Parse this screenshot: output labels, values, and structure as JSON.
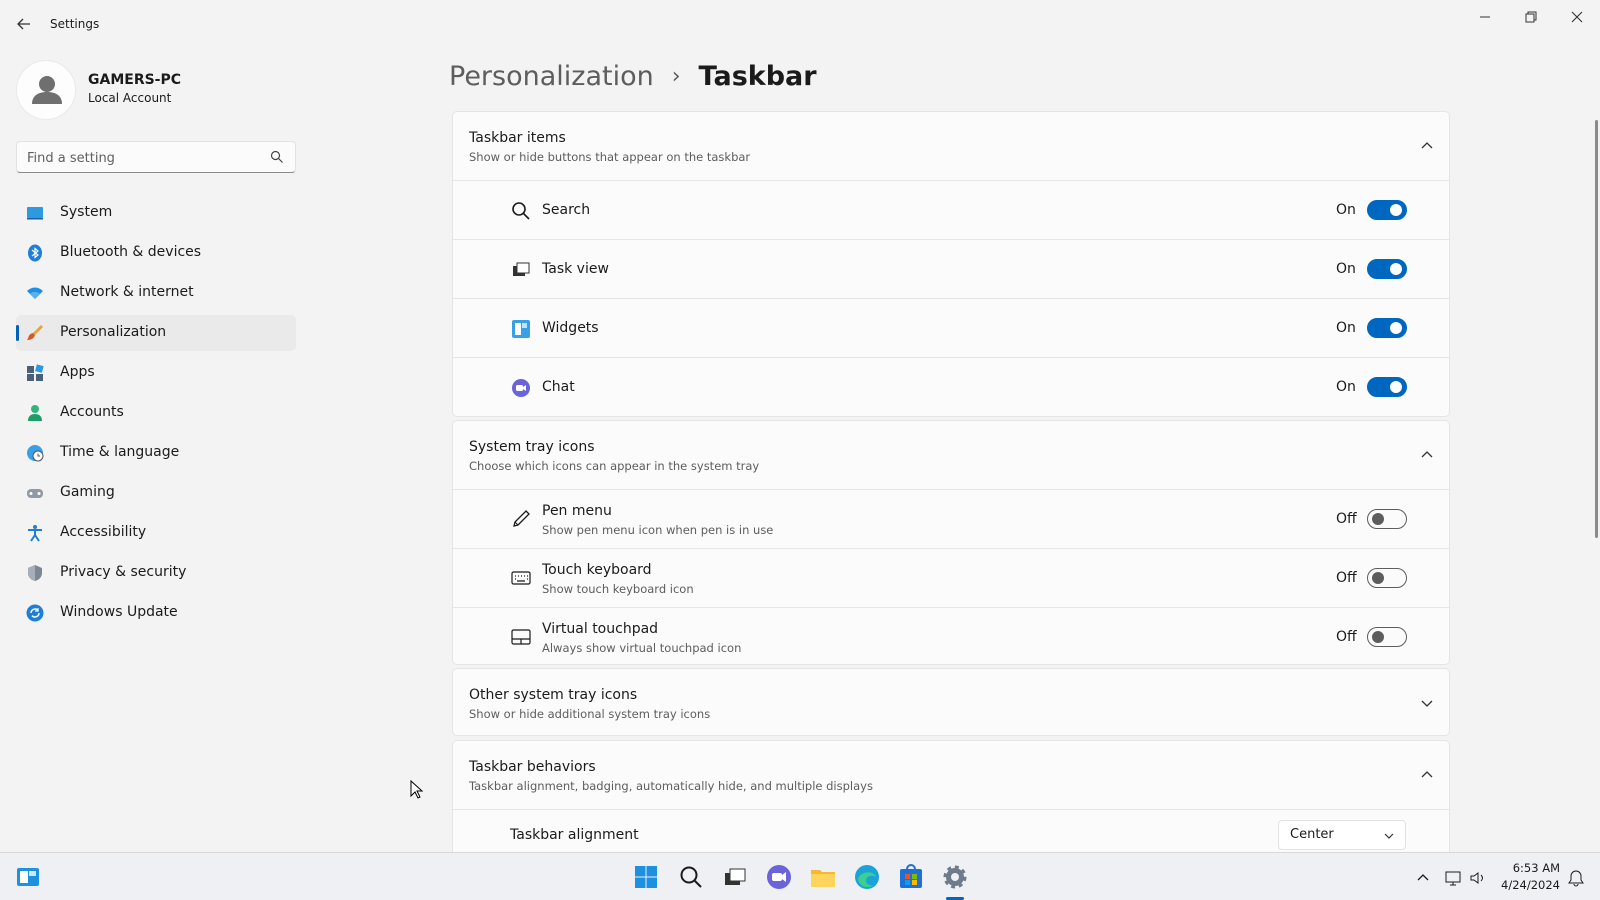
{
  "window": {
    "title": "Settings"
  },
  "profile": {
    "name": "GAMERS-PC",
    "account_type": "Local Account"
  },
  "search": {
    "placeholder": "Find a setting"
  },
  "sidebar": {
    "items": [
      {
        "label": "System",
        "icon": "system-icon"
      },
      {
        "label": "Bluetooth & devices",
        "icon": "bluetooth-icon"
      },
      {
        "label": "Network & internet",
        "icon": "wifi-icon"
      },
      {
        "label": "Personalization",
        "icon": "brush-icon",
        "selected": true
      },
      {
        "label": "Apps",
        "icon": "apps-icon"
      },
      {
        "label": "Accounts",
        "icon": "accounts-icon"
      },
      {
        "label": "Time & language",
        "icon": "globe-clock-icon"
      },
      {
        "label": "Gaming",
        "icon": "gamepad-icon"
      },
      {
        "label": "Accessibility",
        "icon": "accessibility-icon"
      },
      {
        "label": "Privacy & security",
        "icon": "shield-icon"
      },
      {
        "label": "Windows Update",
        "icon": "update-icon"
      }
    ]
  },
  "breadcrumb": {
    "parent": "Personalization",
    "separator": "›",
    "current": "Taskbar"
  },
  "sections": {
    "taskbar_items": {
      "title": "Taskbar items",
      "description": "Show or hide buttons that appear on the taskbar",
      "expanded": true,
      "rows": [
        {
          "label": "Search",
          "state": "On",
          "on": true,
          "icon": "search-icon"
        },
        {
          "label": "Task view",
          "state": "On",
          "on": true,
          "icon": "task-view-icon"
        },
        {
          "label": "Widgets",
          "state": "On",
          "on": true,
          "icon": "widgets-icon"
        },
        {
          "label": "Chat",
          "state": "On",
          "on": true,
          "icon": "chat-icon"
        }
      ]
    },
    "system_tray": {
      "title": "System tray icons",
      "description": "Choose which icons can appear in the system tray",
      "expanded": true,
      "rows": [
        {
          "label": "Pen menu",
          "sub": "Show pen menu icon when pen is in use",
          "state": "Off",
          "on": false,
          "icon": "pen-icon"
        },
        {
          "label": "Touch keyboard",
          "sub": "Show touch keyboard icon",
          "state": "Off",
          "on": false,
          "icon": "keyboard-icon"
        },
        {
          "label": "Virtual touchpad",
          "sub": "Always show virtual touchpad icon",
          "state": "Off",
          "on": false,
          "icon": "touchpad-icon"
        }
      ]
    },
    "other_tray": {
      "title": "Other system tray icons",
      "description": "Show or hide additional system tray icons",
      "expanded": false
    },
    "behaviors": {
      "title": "Taskbar behaviors",
      "description": "Taskbar alignment, badging, automatically hide, and multiple displays",
      "expanded": true,
      "alignment_label": "Taskbar alignment",
      "alignment_value": "Center"
    }
  },
  "taskbar": {
    "time": "6:53 AM",
    "date": "4/24/2024",
    "accent": "#0067c0"
  }
}
